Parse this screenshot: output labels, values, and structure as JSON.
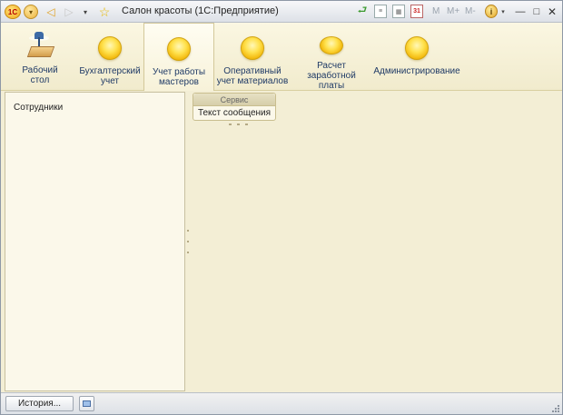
{
  "titlebar": {
    "logo_text": "1С",
    "menu_arrow": "▾",
    "back_arrow": "◁",
    "forward_arrow": "▷",
    "nav_dropdown": "▾",
    "favorite_star": "☆",
    "title": "Салон красоты  (1С:Предприятие)",
    "doc_icon_text": "≡",
    "calc_icon_text": "▦",
    "calendar_icon_text": "31",
    "memory_buttons": [
      "M",
      "M+",
      "M-"
    ],
    "info_icon_text": "i",
    "info_dropdown": "▾",
    "minimize": "—",
    "maximize": "□",
    "close": "✕"
  },
  "sections": [
    {
      "label": "Рабочий\nстол",
      "icon": "desktop-icon"
    },
    {
      "label": "Бухгалтерский\nучет",
      "icon": "section-bulb-icon"
    },
    {
      "label": "Учет работы\nмастеров",
      "icon": "section-bulb-icon",
      "active": true
    },
    {
      "label": "Оперативный\nучет материалов",
      "icon": "section-bulb-icon"
    },
    {
      "label": "Расчет\nзаработной платы",
      "icon": "section-bulb-icon"
    },
    {
      "label": "Администрирование",
      "icon": "section-bulb-icon"
    }
  ],
  "navigation_panel": {
    "items": [
      "Сотрудники"
    ]
  },
  "actions_panel": {
    "group_title": "Сервис",
    "commands": [
      "Текст сообщения"
    ]
  },
  "bottombar": {
    "history_label": "История..."
  },
  "colors": {
    "background": "#f3eed5",
    "section_label": "#1f3a66",
    "bulb": "#ffe24f"
  }
}
